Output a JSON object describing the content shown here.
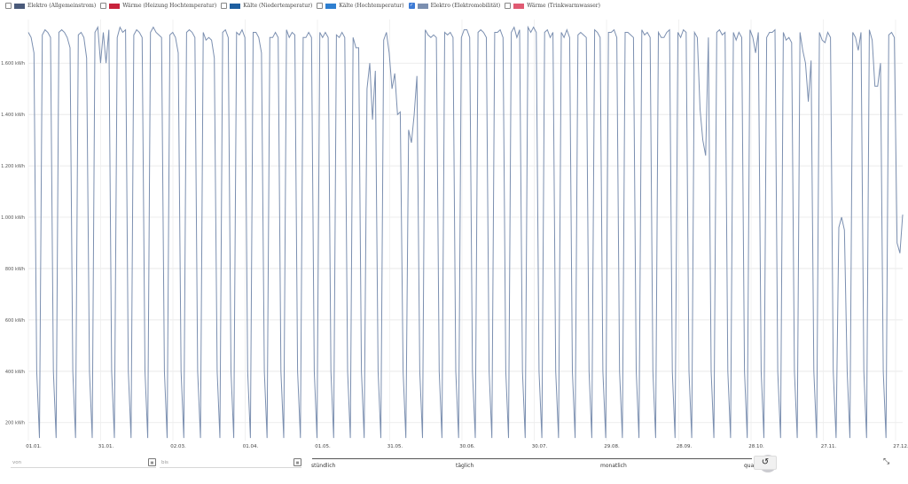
{
  "legend": [
    {
      "label": "Elektro (Allgemeinstrom)",
      "color": "#4a5a7a",
      "checked": false
    },
    {
      "label": "Wärme (Heizung Hochtemperatur)",
      "color": "#c8233c",
      "checked": false
    },
    {
      "label": "Kälte (Niedertemperatur)",
      "color": "#1e5fa0",
      "checked": false
    },
    {
      "label": "Kälte (Hochtemperatur)",
      "color": "#2e7fd0",
      "checked": false
    },
    {
      "label": "Elektro (Elektromobilität)",
      "color": "#7b8fb0",
      "checked": true
    },
    {
      "label": "Wärme (Trinkwarmwasser)",
      "color": "#e05a72",
      "checked": false
    }
  ],
  "controls": {
    "from_placeholder": "von",
    "to_placeholder": "bis",
    "granularity_options": [
      "stündlich",
      "täglich",
      "monatlich",
      "quar"
    ],
    "granularity_selected": "täglich",
    "reset_icon": "reset-icon",
    "pin_icon": "pin-icon"
  },
  "chart_data": {
    "type": "line",
    "series": [
      {
        "name": "Elektro (Elektromobilität)",
        "color": "#7b8fb0"
      }
    ],
    "y_unit": "kWh",
    "y_ticks": [
      {
        "value": 200,
        "label": "200 kWh"
      },
      {
        "value": 400,
        "label": "400 kWh"
      },
      {
        "value": 600,
        "label": "600 kWh"
      },
      {
        "value": 800,
        "label": "800 kWh"
      },
      {
        "value": 1000,
        "label": "1.000 kWh"
      },
      {
        "value": 1200,
        "label": "1.200 kWh"
      },
      {
        "value": 1400,
        "label": "1.400 kWh"
      },
      {
        "value": 1600,
        "label": "1.600 kWh"
      }
    ],
    "x_ticks": [
      "01.01.",
      "31.01.",
      "02.03.",
      "01.04.",
      "01.05.",
      "31.05.",
      "30.06.",
      "30.07.",
      "29.08.",
      "28.09.",
      "28.10.",
      "27.11.",
      "27.12."
    ],
    "ylim": [
      130,
      1770
    ],
    "grid": true,
    "daily_values": [
      1720,
      1700,
      1640,
      400,
      140,
      1710,
      1730,
      1720,
      1700,
      400,
      140,
      1720,
      1730,
      1720,
      1700,
      1660,
      400,
      140,
      1710,
      1720,
      1700,
      1620,
      400,
      140,
      1720,
      1740,
      1600,
      1720,
      1600,
      1730,
      400,
      140,
      1700,
      1740,
      1720,
      1730,
      400,
      140,
      1710,
      1730,
      1720,
      1700,
      400,
      140,
      1720,
      1740,
      1720,
      1710,
      1700,
      400,
      140,
      1710,
      1720,
      1700,
      1640,
      400,
      140,
      1720,
      1730,
      1720,
      1700,
      400,
      140,
      1720,
      1690,
      1700,
      1690,
      1620,
      400,
      140,
      1720,
      1730,
      1700,
      400,
      140,
      1720,
      1710,
      1730,
      1700,
      400,
      140,
      1720,
      1720,
      1700,
      1640,
      400,
      140,
      1700,
      1700,
      1720,
      1700,
      400,
      140,
      1730,
      1700,
      1720,
      1710,
      400,
      140,
      1700,
      1700,
      1720,
      1700,
      400,
      140,
      1720,
      1700,
      1720,
      1700,
      400,
      140,
      1710,
      1700,
      1720,
      1700,
      400,
      140,
      1700,
      1660,
      1660,
      400,
      140,
      1500,
      1600,
      1380,
      1570,
      400,
      140,
      1690,
      1720,
      1640,
      1500,
      1560,
      1400,
      1410,
      400,
      140,
      1340,
      1290,
      1400,
      1550,
      400,
      140,
      1730,
      1710,
      1700,
      1710,
      1700,
      400,
      140,
      1720,
      1710,
      1720,
      1700,
      400,
      140,
      1700,
      1730,
      1730,
      1700,
      400,
      140,
      1720,
      1730,
      1720,
      1700,
      400,
      140,
      1720,
      1720,
      1730,
      1700,
      400,
      140,
      1720,
      1740,
      1700,
      1730,
      400,
      140,
      1740,
      1720,
      1740,
      1720,
      400,
      140,
      1720,
      1730,
      1700,
      1720,
      400,
      140,
      1720,
      1700,
      1730,
      1700,
      400,
      140,
      1710,
      1720,
      1710,
      1700,
      400,
      140,
      1730,
      1720,
      1700,
      400,
      140,
      1720,
      1720,
      1730,
      1700,
      400,
      140,
      1720,
      1720,
      1710,
      1700,
      400,
      140,
      1730,
      1710,
      1720,
      1700,
      400,
      140,
      1720,
      1700,
      1700,
      1720,
      1730,
      400,
      140,
      1720,
      1700,
      1730,
      1720,
      400,
      140,
      1720,
      1700,
      1420,
      1300,
      1240,
      1700,
      400,
      140,
      1720,
      1730,
      1710,
      1720,
      400,
      140,
      1720,
      1690,
      1720,
      1700,
      400,
      140,
      1730,
      1700,
      1640,
      1720,
      400,
      140,
      1700,
      1720,
      1720,
      1730,
      400,
      140,
      1720,
      1690,
      1700,
      1680,
      400,
      140,
      1720,
      1650,
      1600,
      1450,
      1610,
      400,
      140,
      1720,
      1690,
      1680,
      1720,
      1700,
      400,
      140,
      960,
      1000,
      950,
      400,
      140,
      1720,
      1700,
      1650,
      1720,
      400,
      140,
      1730,
      1690,
      1510,
      1510,
      1600,
      400,
      140,
      1710,
      1720,
      1700,
      900,
      860,
      1010
    ]
  }
}
